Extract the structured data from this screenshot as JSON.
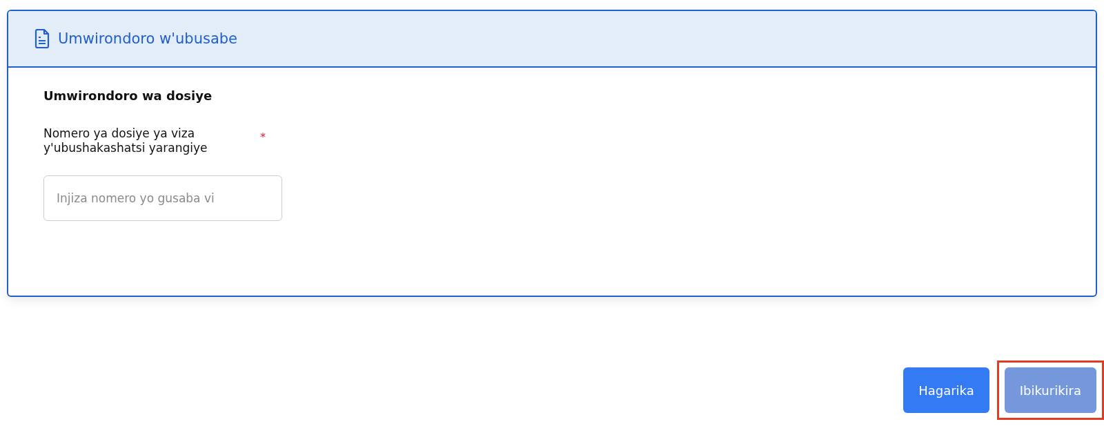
{
  "panel": {
    "title": "Umwirondoro w'ubusabe"
  },
  "section": {
    "heading": "Umwirondoro wa dosiye"
  },
  "field": {
    "label": "Nomero ya dosiye ya viza y'ubushakashatsi yarangiye",
    "required": true,
    "required_mark": "*",
    "placeholder": "Injiza nomero yo gusaba vi"
  },
  "buttons": [
    {
      "label": "Hagarika",
      "disabled": false,
      "highlighted": false
    },
    {
      "label": "Ibikurikira",
      "disabled": true,
      "highlighted": true
    }
  ]
}
